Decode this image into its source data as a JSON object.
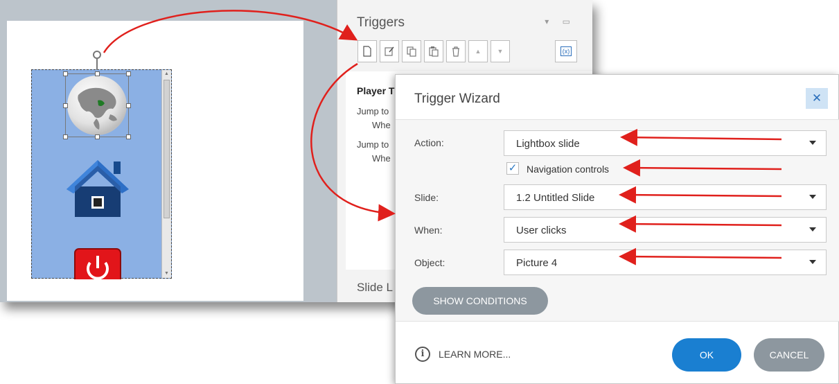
{
  "panel": {
    "title": "Triggers",
    "group_title": "Player T",
    "items": [
      {
        "line1": "Jump to",
        "line2": "Whe"
      },
      {
        "line1": "Jump to",
        "line2": "Whe"
      }
    ],
    "slide_layers_label": "Slide L"
  },
  "toolbar": {
    "icons": [
      "new-trigger-icon",
      "edit-trigger-icon",
      "copy-icon",
      "paste-icon",
      "delete-icon",
      "move-up-icon",
      "move-down-icon",
      "variables-icon"
    ]
  },
  "dialog": {
    "title": "Trigger Wizard",
    "close_label": "✕",
    "fields": {
      "action": {
        "label": "Action:",
        "value": "Lightbox slide"
      },
      "navigation_controls": {
        "label": "Navigation controls",
        "checked": true
      },
      "slide": {
        "label": "Slide:",
        "value": "1.2 Untitled Slide"
      },
      "when": {
        "label": "When:",
        "value": "User clicks"
      },
      "object": {
        "label": "Object:",
        "value": "Picture 4"
      }
    },
    "show_conditions_label": "SHOW CONDITIONS",
    "learn_more_label": "LEARN MORE...",
    "ok_label": "OK",
    "cancel_label": "CANCEL"
  },
  "colors": {
    "accent": "#1a7fd1",
    "annotation_arrow": "#e0201c",
    "watermark": "#8fd11f"
  }
}
